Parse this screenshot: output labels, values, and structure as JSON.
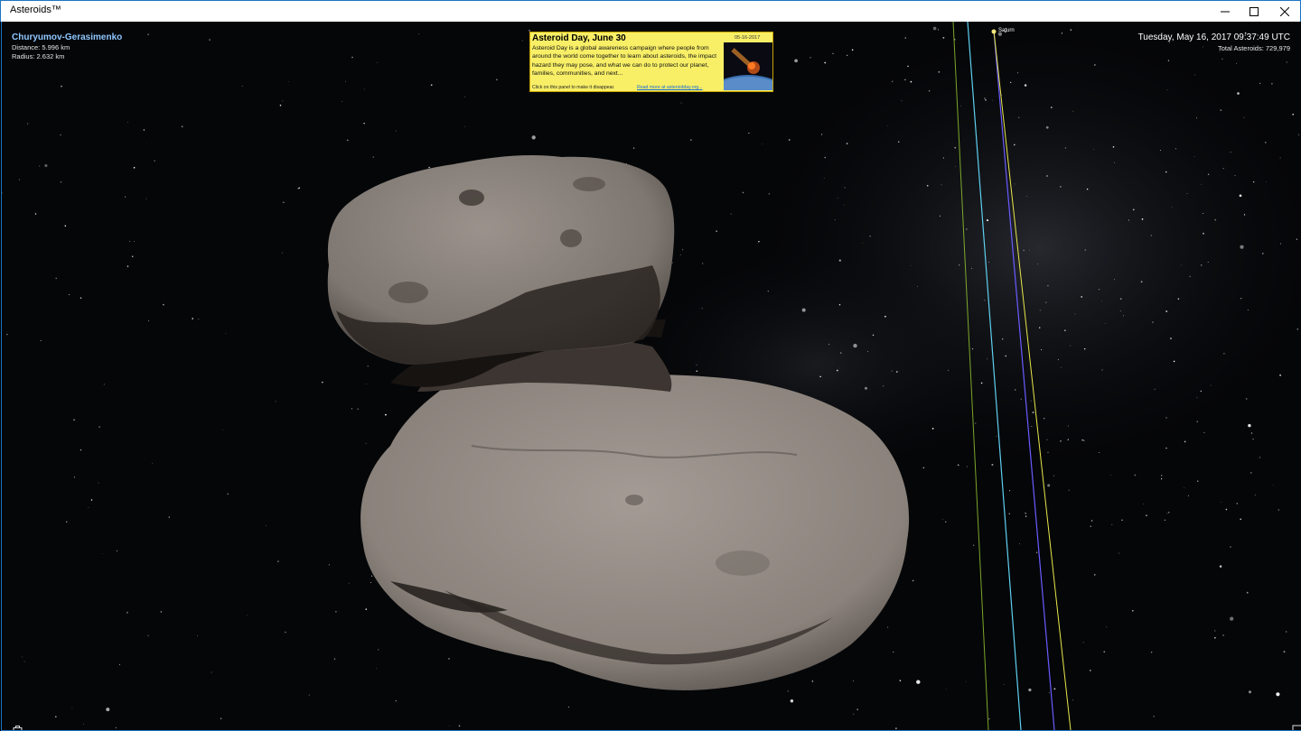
{
  "window": {
    "title": "Asteroids™",
    "controls": [
      "minimize-icon",
      "maximize-icon",
      "close-icon"
    ]
  },
  "object": {
    "name": "Churyumov-Gerasimenko",
    "distance": "Distance: 5.996 km",
    "radius": "Radius: 2.632 km"
  },
  "status": {
    "datetime": "Tuesday, May 16, 2017 09:37:49 UTC",
    "total_asteroids": "Total Asteroids:  729,979"
  },
  "news": {
    "title": "Asteroid Day, June 30",
    "date": "05-16-2017",
    "body": "Asteroid Day is a global awareness campaign where people from around the world come together to learn about asteroids, the impact hazard they may pose, and what we can do to protect our planet, families, communities, and next...",
    "hint": "Click on this panel to make it disappear.",
    "link": "Read more at asteroidday.org..."
  },
  "planet_label": "Saturn",
  "icons": {
    "bottom_left": "bag-icon",
    "bottom_right": "presentation-icon"
  },
  "colors": {
    "object_name": "#8fc7ff",
    "news_bg": "#f8ef67",
    "link": "#1a6fd0",
    "window_border": "#1c74c4"
  }
}
